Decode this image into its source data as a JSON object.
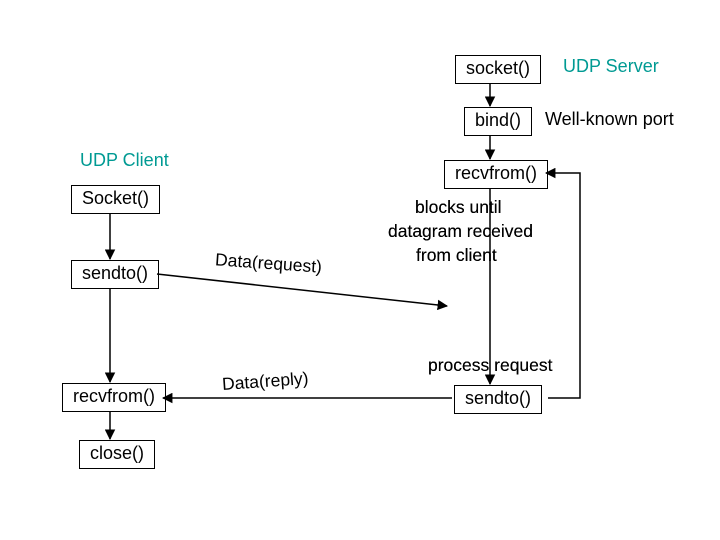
{
  "client_title": "UDP Client",
  "server_title": "UDP Server",
  "wellknown": "Well-known port",
  "c_socket": "Socket()",
  "c_sendto": "sendto()",
  "c_recvfrom": "recvfrom()",
  "c_close": "close()",
  "s_socket": "socket()",
  "s_bind": "bind()",
  "s_recvfrom": "recvfrom()",
  "s_sendto": "sendto()",
  "blocks1": "blocks until",
  "blocks2": "datagram received",
  "blocks3": "from client",
  "process": "process request",
  "data_req": "Data(request)",
  "data_reply": "Data(reply)"
}
